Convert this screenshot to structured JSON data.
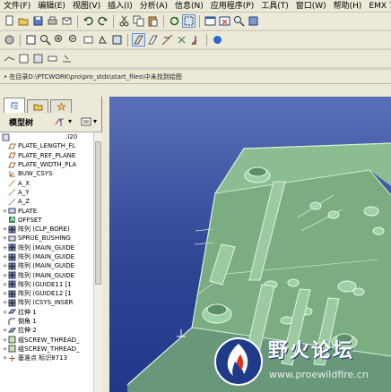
{
  "menubar": {
    "items": [
      "文件(F)",
      "编辑(E)",
      "视图(V)",
      "插入(I)",
      "分析(A)",
      "信息(N)",
      "应用程序(P)",
      "工具(T)",
      "窗口(W)",
      "帮助(H)",
      "EMX 7"
    ]
  },
  "toolbar": {
    "row1_icons": [
      "new-icon",
      "open-icon",
      "save-icon",
      "print-icon",
      "email-icon",
      "undo-icon",
      "redo-icon",
      "cut-icon",
      "copy-icon",
      "paste-icon",
      "regenerate-icon",
      "select-filter-icon",
      "window-icon",
      "close-window-icon",
      "zoom-icon",
      "shading-icon"
    ],
    "row2_icons": [
      "sketch-icon",
      "plane-icon",
      "axis-icon",
      "point-icon",
      "csys-icon",
      "spin-icon",
      "zoom-in-icon",
      "zoom-out-icon",
      "refit-icon",
      "orient-icon",
      "saved-views-icon",
      "layers-icon",
      "appearance-icon",
      "model-display-icon"
    ],
    "row3_icons": [
      "datum-plane-display-icon",
      "datum-axis-display-icon",
      "datum-point-display-icon",
      "csys-display-icon",
      "annotation-display-icon"
    ]
  },
  "workdir": {
    "text": "• 在目录D:\\PTCWORK\\pro\\pro_stds\\start_files\\中未找到绘图"
  },
  "model_tree": {
    "title": "模型树",
    "root": ".I20",
    "items": [
      {
        "label": "PLATE_LENGTH_FL",
        "icon": "datum-plane-icon",
        "expandable": false
      },
      {
        "label": "PLATE_REF_PLANE",
        "icon": "datum-plane-icon",
        "expandable": false
      },
      {
        "label": "PLATE_WIDTH_PLA",
        "icon": "datum-plane-icon",
        "expandable": false
      },
      {
        "label": "BUW_CSYS",
        "icon": "csys-icon",
        "expandable": false
      },
      {
        "label": "A_X",
        "icon": "datum-axis-icon",
        "expandable": false
      },
      {
        "label": "A_Y",
        "icon": "datum-axis-icon",
        "expandable": false
      },
      {
        "label": "A_Z",
        "icon": "datum-axis-icon",
        "expandable": false
      },
      {
        "label": "PLATE",
        "icon": "part-icon",
        "expandable": true
      },
      {
        "label": "OFFSET",
        "icon": "offset-icon",
        "expandable": false
      },
      {
        "label": "阵列 (CLP_BORE)",
        "icon": "pattern-icon",
        "expandable": true
      },
      {
        "label": "SPRUE_BUSHING",
        "icon": "component-icon",
        "expandable": true
      },
      {
        "label": "阵列 (MAIN_GUIDE",
        "icon": "pattern-icon",
        "expandable": true
      },
      {
        "label": "阵列 (MAIN_GUIDE",
        "icon": "pattern-icon",
        "expandable": true
      },
      {
        "label": "阵列 (MAIN_GUIDE",
        "icon": "pattern-icon",
        "expandable": true
      },
      {
        "label": "阵列 (MAIN_GUIDE",
        "icon": "pattern-icon",
        "expandable": true
      },
      {
        "label": "阵列 (GUIDE11 [1",
        "icon": "pattern-icon",
        "expandable": true
      },
      {
        "label": "阵列 (GUIDE12 [1",
        "icon": "pattern-icon",
        "expandable": true
      },
      {
        "label": "阵列 (CSYS_INSER",
        "icon": "pattern-icon",
        "expandable": true
      },
      {
        "label": "拉伸 1",
        "icon": "extrude-icon",
        "expandable": true
      },
      {
        "label": "倒角 1",
        "icon": "chamfer-icon",
        "expandable": false
      },
      {
        "label": "拉伸 2",
        "icon": "extrude-icon",
        "expandable": true
      },
      {
        "label": "组SCREW_THREAD_",
        "icon": "group-icon",
        "expandable": true
      },
      {
        "label": "组SCREW_THREAD_",
        "icon": "group-icon",
        "expandable": true
      },
      {
        "label": "基准点 标识8713",
        "icon": "datum-point-icon",
        "expandable": true
      }
    ]
  },
  "watermark": {
    "title": "野火论坛",
    "url": "www.proewildfire.cn"
  },
  "colors": {
    "viewport_top": "#5a6fb8",
    "viewport_bottom": "#22378a",
    "model": "#86b886",
    "model_edge": "#d4ecd4"
  }
}
